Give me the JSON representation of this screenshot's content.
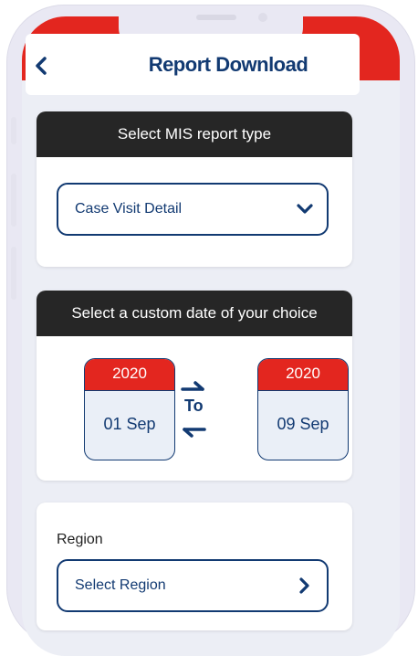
{
  "header": {
    "title": "Report Download"
  },
  "report_type": {
    "heading": "Select MIS report type",
    "selected": "Case Visit Detail"
  },
  "date_range": {
    "heading": "Select a custom date of your choice",
    "from": {
      "year": "2020",
      "day": "01 Sep"
    },
    "separator": "To",
    "to": {
      "year": "2020",
      "day": "09 Sep"
    }
  },
  "region": {
    "label": "Region",
    "placeholder": "Select Region"
  },
  "colors": {
    "brand_navy": "#123a72",
    "accent_red": "#e3261f",
    "card_head": "#262626"
  }
}
